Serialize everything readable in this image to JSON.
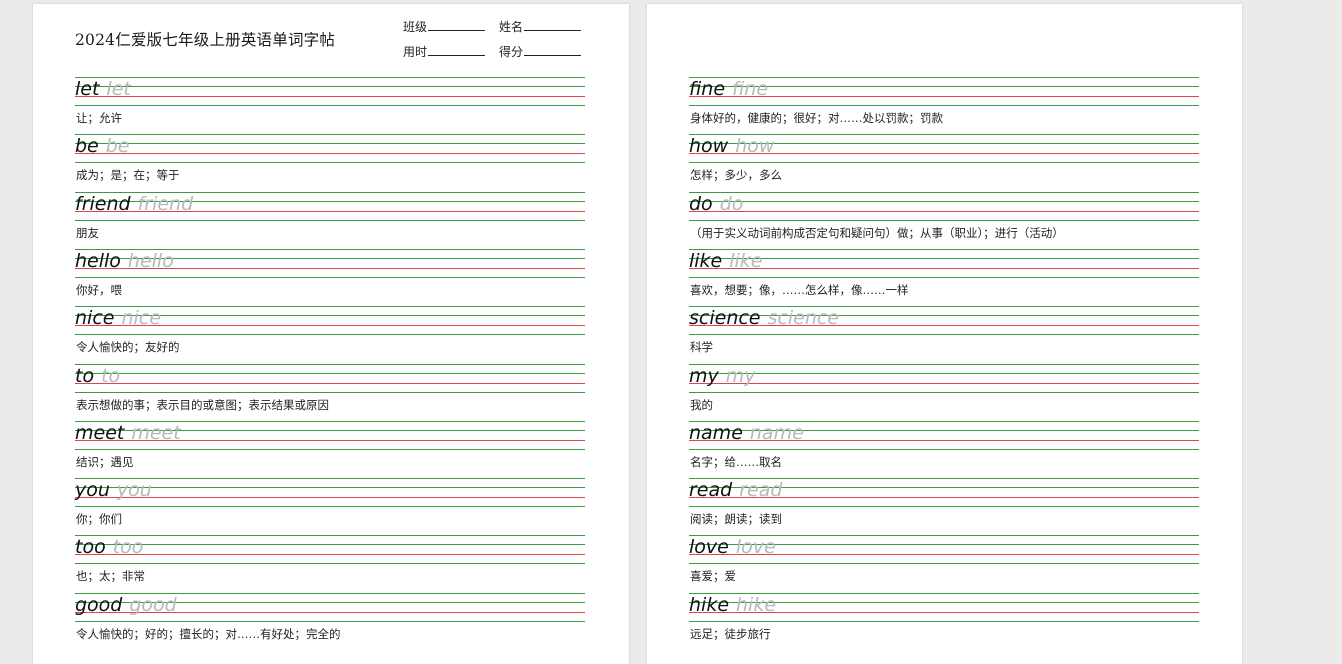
{
  "header": {
    "title": "2024仁爱版七年级上册英语单词字帖",
    "fields": {
      "class_label": "班级",
      "name_label": "姓名",
      "time_label": "用时",
      "score_label": "得分"
    }
  },
  "left_page": {
    "words": [
      {
        "word": "let",
        "meaning": "让；允许"
      },
      {
        "word": "be",
        "meaning": "成为；是；在；等于"
      },
      {
        "word": "friend",
        "meaning": "朋友"
      },
      {
        "word": "hello",
        "meaning": "你好，喂"
      },
      {
        "word": "nice",
        "meaning": "令人愉快的；友好的"
      },
      {
        "word": "to",
        "meaning": "表示想做的事；表示目的或意图；表示结果或原因"
      },
      {
        "word": "meet",
        "meaning": "结识；遇见"
      },
      {
        "word": "you",
        "meaning": "你；你们"
      },
      {
        "word": "too",
        "meaning": "也；太；非常"
      },
      {
        "word": "good",
        "meaning": "令人愉快的；好的；擅长的；对……有好处；完全的"
      }
    ]
  },
  "right_page": {
    "words": [
      {
        "word": "fine",
        "meaning": "身体好的，健康的；很好；对……处以罚款；罚款"
      },
      {
        "word": "how",
        "meaning": "怎样；多少，多么"
      },
      {
        "word": "do",
        "meaning": "（用于实义动词前构成否定句和疑问句）做；从事（职业）；进行（活动）"
      },
      {
        "word": "like",
        "meaning": "喜欢，想要；像，……怎么样，像……一样"
      },
      {
        "word": "science",
        "meaning": "科学"
      },
      {
        "word": "my",
        "meaning": "我的"
      },
      {
        "word": "name",
        "meaning": "名字；给……取名"
      },
      {
        "word": "read",
        "meaning": "阅读；朗读；读到"
      },
      {
        "word": "love",
        "meaning": "喜爱；爱"
      },
      {
        "word": "hike",
        "meaning": "远足；徒步旅行"
      }
    ]
  },
  "colors": {
    "green_rule": "#3a9a3f",
    "red_rule": "#e0454b",
    "trace_text": "#b8b8b8",
    "background": "#ecebe9"
  }
}
